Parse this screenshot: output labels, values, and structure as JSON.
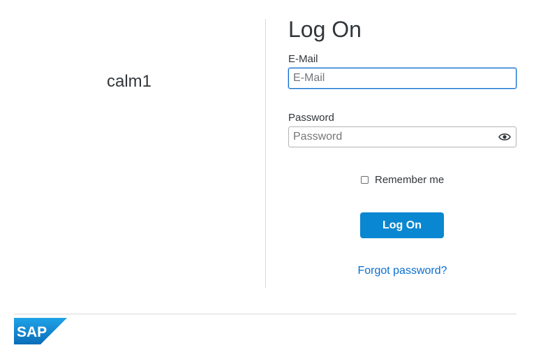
{
  "tenant": {
    "name": "calm1"
  },
  "form": {
    "title": "Log On",
    "email": {
      "label": "E-Mail",
      "placeholder": "E-Mail",
      "value": ""
    },
    "password": {
      "label": "Password",
      "placeholder": "Password",
      "value": ""
    },
    "remember": {
      "label": "Remember me",
      "checked": false
    },
    "submit_label": "Log On",
    "forgot_label": "Forgot password?"
  },
  "footer": {
    "logo_text": "SAP"
  },
  "colors": {
    "accent": "#0a87d1",
    "link": "#0a6ed1",
    "logo_top": "#1fa3e8",
    "logo_bottom": "#0b6db7"
  },
  "icons": {
    "password_toggle": "eye-icon"
  }
}
